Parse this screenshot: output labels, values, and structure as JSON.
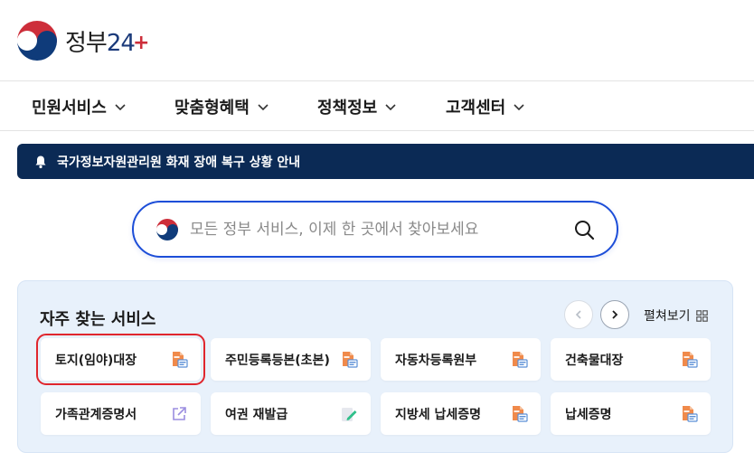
{
  "header": {
    "logo_text": "정부",
    "logo_num": "24",
    "logo_plus": "+"
  },
  "nav": {
    "items": [
      {
        "label": "민원서비스"
      },
      {
        "label": "맞춤형혜택"
      },
      {
        "label": "정책정보"
      },
      {
        "label": "고객센터"
      }
    ]
  },
  "notice": {
    "text": "국가정보자원관리원 화재 장애 복구 상황 안내",
    "icon": "bell-icon"
  },
  "search": {
    "placeholder": "모든 정부 서비스, 이제 한 곳에서 찾아보세요",
    "value": ""
  },
  "services": {
    "title": "자주 찾는 서비스",
    "expand_label": "펼쳐보기",
    "items": [
      {
        "label": "토지(임야)대장",
        "icon": "pdf-document-icon",
        "selected": true
      },
      {
        "label": "주민등록등본(초본)",
        "icon": "pdf-document-icon"
      },
      {
        "label": "자동차등록원부",
        "icon": "pdf-document-icon"
      },
      {
        "label": "건축물대장",
        "icon": "pdf-document-icon"
      },
      {
        "label": "가족관계증명서",
        "icon": "external-link-icon"
      },
      {
        "label": "여권 재발급",
        "icon": "edit-document-icon"
      },
      {
        "label": "지방세 납세증명",
        "icon": "pdf-document-icon"
      },
      {
        "label": "납세증명",
        "icon": "pdf-document-icon"
      }
    ]
  },
  "colors": {
    "brand_navy": "#0b2a55",
    "search_border": "#1d4ed8",
    "panel_bg": "#e8f1fb",
    "pdf_orange": "#f08a4b",
    "highlight_red": "#e0262d"
  }
}
